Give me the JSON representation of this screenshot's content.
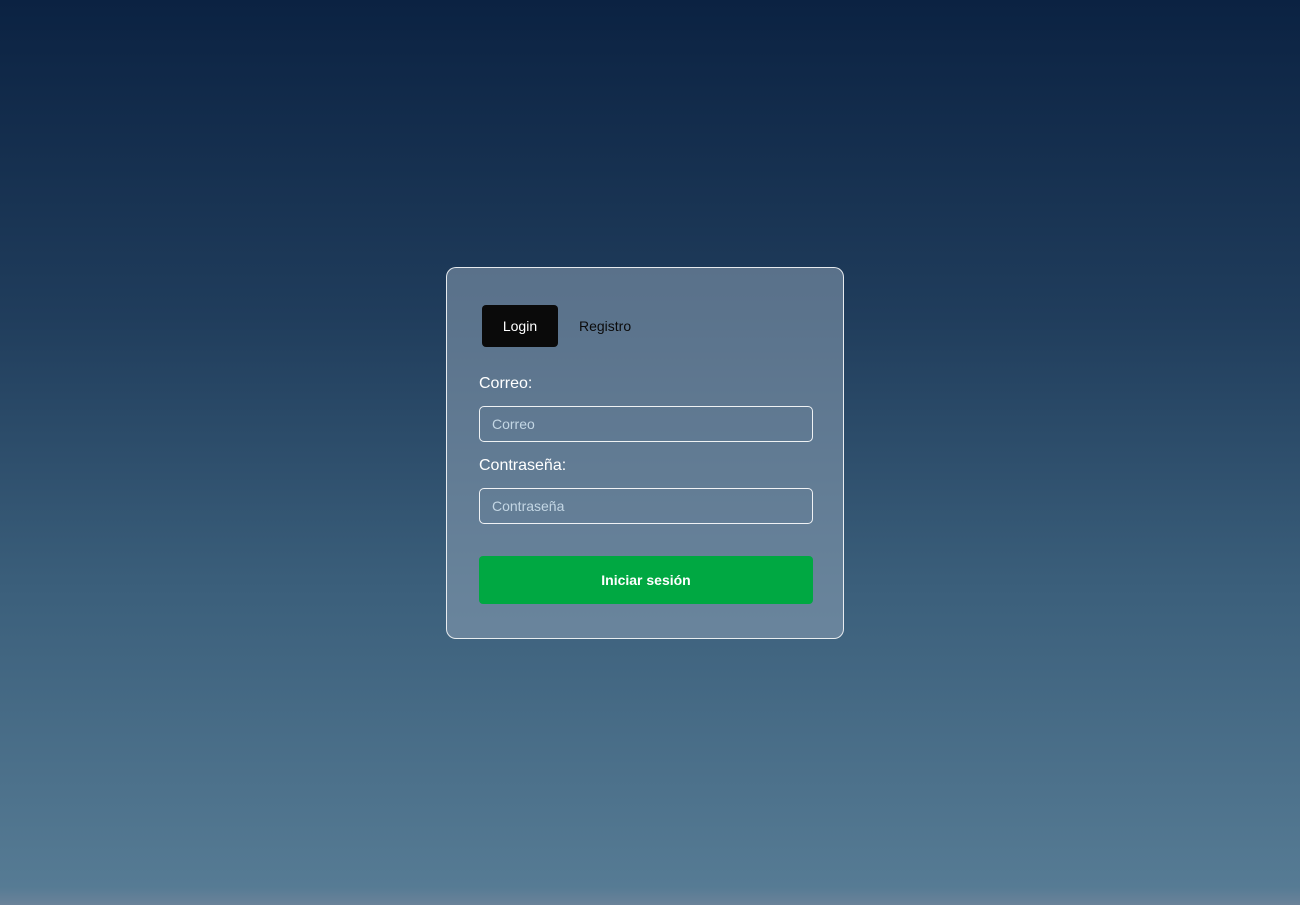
{
  "tabs": {
    "login_label": "Login",
    "register_label": "Registro"
  },
  "form": {
    "email_label": "Correo:",
    "email_placeholder": "Correo",
    "email_value": "",
    "password_label": "Contraseña:",
    "password_placeholder": "Contraseña",
    "password_value": "",
    "submit_label": "Iniciar sesión"
  },
  "colors": {
    "submit_button": "#00a842",
    "active_tab": "#0a0a0a"
  }
}
